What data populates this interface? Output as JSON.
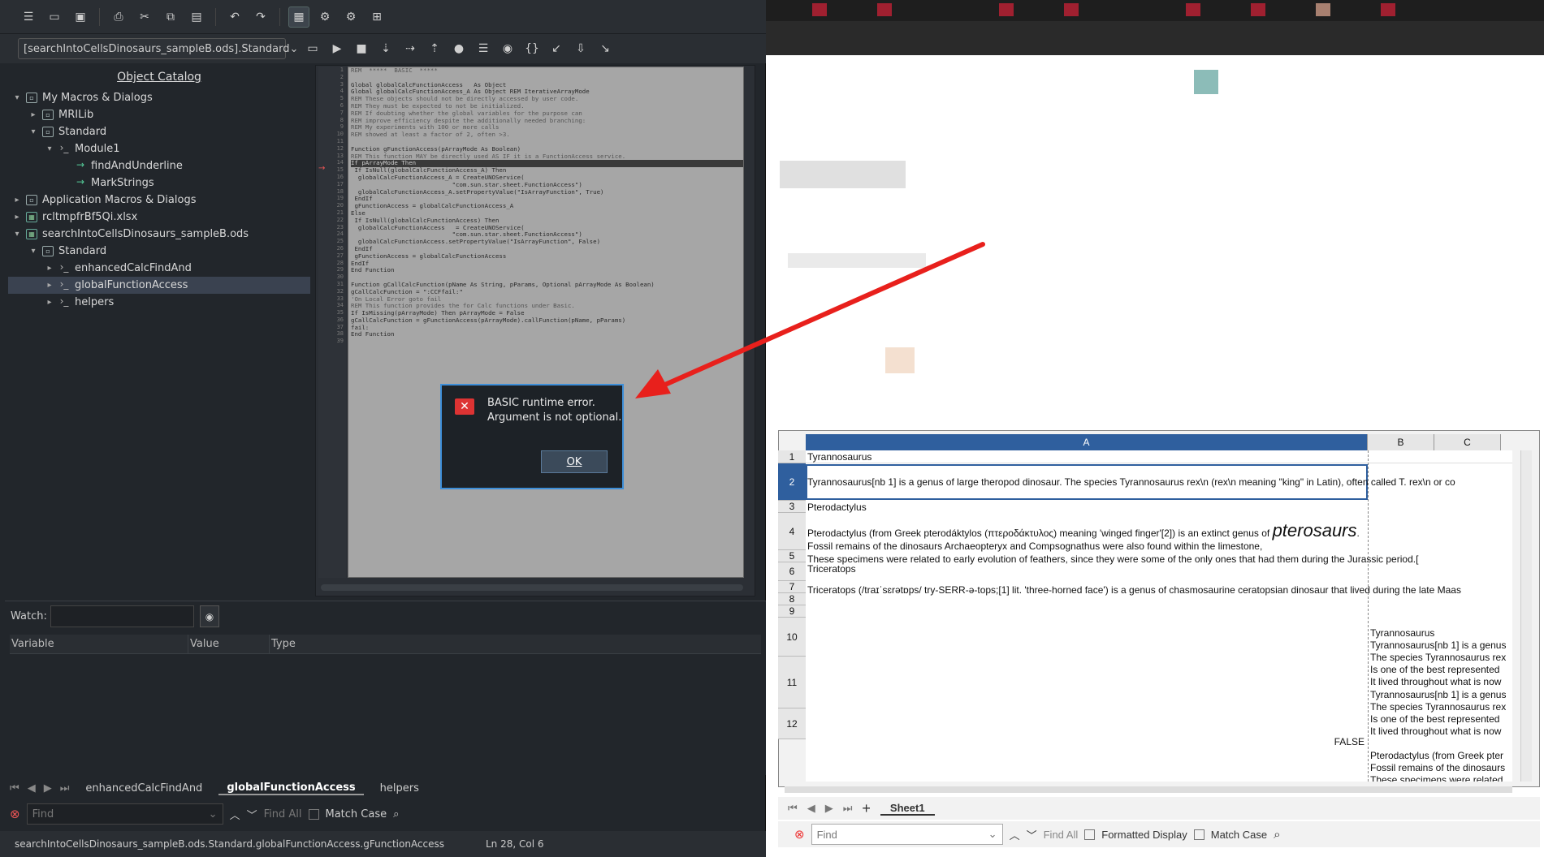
{
  "ide": {
    "library_select": "[searchIntoCellsDinosaurs_sampleB.ods].Standard",
    "catalog_title": "Object Catalog",
    "tree": [
      {
        "label": "My Macros & Dialogs",
        "level": 0,
        "icon": "box",
        "twisty": "▾"
      },
      {
        "label": "MRILib",
        "level": 1,
        "icon": "box",
        "twisty": "▸"
      },
      {
        "label": "Standard",
        "level": 1,
        "icon": "box",
        "twisty": "▾"
      },
      {
        "label": "Module1",
        "level": 2,
        "icon": "module",
        "twisty": "▾"
      },
      {
        "label": "findAndUnderline",
        "level": 3,
        "icon": "method",
        "twisty": ""
      },
      {
        "label": "MarkStrings",
        "level": 3,
        "icon": "method",
        "twisty": ""
      },
      {
        "label": "Application Macros & Dialogs",
        "level": 0,
        "icon": "box",
        "twisty": "▸"
      },
      {
        "label": "rcltmpfrBf5Qi.xlsx",
        "level": 0,
        "icon": "sheet",
        "twisty": "▸"
      },
      {
        "label": "searchIntoCellsDinosaurs_sampleB.ods",
        "level": 0,
        "icon": "sheet",
        "twisty": "▾"
      },
      {
        "label": "Standard",
        "level": 1,
        "icon": "box",
        "twisty": "▾"
      },
      {
        "label": "enhancedCalcFindAnd",
        "level": 2,
        "icon": "module",
        "twisty": "▸"
      },
      {
        "label": "globalFunctionAccess",
        "level": 2,
        "icon": "module",
        "twisty": "▸",
        "selected": true
      },
      {
        "label": "helpers",
        "level": 2,
        "icon": "module",
        "twisty": "▸"
      }
    ],
    "code_lines": [
      "REM  *****  BASIC  *****",
      "",
      "Global globalCalcFunctionAccess   As Object",
      "Global globalCalcFunctionAccess_A As Object REM IterativeArrayMode",
      "REM These objects should not be directly accessed by user code.",
      "REM They must be expected to not be initialized.",
      "REM If doubting whether the global variables for the purpose can",
      "REM improve efficiency despite the additionally needed branching:",
      "REM My experiments with 100 or more calls",
      "REM showed at least a factor of 2, often >3.",
      "",
      "Function gFunctionAccess(pArrayMode As Boolean)",
      "REM This function MAY be directly used AS IF it is a FunctionAccess service.",
      "If pArrayMode Then",
      " If IsNull(globalCalcFunctionAccess_A) Then",
      "  globalCalcFunctionAccess_A = CreateUNOService(",
      "                            \"com.sun.star.sheet.FunctionAccess\")",
      "  globalCalcFunctionAccess_A.setPropertyValue(\"IsArrayFunction\", True)",
      " EndIf",
      " gFunctionAccess = globalCalcFunctionAccess_A",
      "Else",
      " If IsNull(globalCalcFunctionAccess) Then",
      "  globalCalcFunctionAccess   = CreateUNOService(",
      "                            \"com.sun.star.sheet.FunctionAccess\")",
      "  globalCalcFunctionAccess.setPropertyValue(\"IsArrayFunction\", False)",
      " EndIf",
      " gFunctionAccess = globalCalcFunctionAccess",
      "EndIf",
      "End Function",
      "",
      "Function gCallCalcFunction(pName As String, pParams, Optional pArrayMode As Boolean)",
      "gCallCalcFunction = \":CCFfail:\"",
      "'On Local Error goto fail",
      "REM This function provides the for Calc functions under Basic.",
      "If IsMissing(pArrayMode) Then pArrayMode = False",
      "gCallCalcFunction = gFunctionAccess(pArrayMode).callFunction(pName, pParams)",
      "fail:",
      "End Function",
      ""
    ],
    "watch_label": "Watch:",
    "watch_columns": [
      "Variable",
      "Value",
      "Type"
    ],
    "module_tabs": [
      "enhancedCalcFindAnd",
      "globalFunctionAccess",
      "helpers"
    ],
    "active_tab": "globalFunctionAccess",
    "find_placeholder": "Find",
    "find_all": "Find All",
    "match_case": "Match Case",
    "status_path": "searchIntoCellsDinosaurs_sampleB.ods.Standard.globalFunctionAccess.gFunctionAccess",
    "status_position": "Ln 28, Col 6"
  },
  "dialog": {
    "line1": "BASIC runtime error.",
    "line2": "Argument is not optional.",
    "ok_label": "OK",
    "icon": "error-icon"
  },
  "calc": {
    "columns": [
      "A",
      "B",
      "C"
    ],
    "rows": [
      "1",
      "2",
      "3",
      "4",
      "5",
      "6",
      "7",
      "8",
      "9",
      "10",
      "11",
      "12"
    ],
    "cells": {
      "r1a": "Tyrannosaurus",
      "r2a": "Tyrannosaurus[nb 1] is a genus of large theropod dinosaur. The species Tyrannosaurus rex\\n (rex\\n meaning \"king\" in Latin), often called T. rex\\n or co",
      "r3a": "Pterodactylus",
      "r4a_1": "Pterodactylus (from Greek pterodáktylos (πτεροδάκτυλος) meaning 'winged finger'[2]) is an extinct genus of",
      "r4a_big": "pterosaurs",
      "r4a_dot": ".",
      "r4a_2": "Fossil remains of the dinosaurs Archaeopteryx and Compsognathus were also found within the limestone,",
      "r4a_3": "These specimens were related to early evolution of feathers, since they were some of the only ones that had them during the Jurassic period.[",
      "r5a": "Triceratops",
      "r6a": "Triceratops (/traɪˈsɛrətɒps/ try-SERR-ə-tops;[1] lit. 'three-horned face') is a genus of chasmosaurine ceratopsian dinosaur that lived during the late Maas",
      "r9b": "Tyrannosaurus",
      "r10b": [
        "Tyrannosaurus[nb 1] is a genus",
        "The species Tyrannosaurus rex",
        "Is one of the best represented",
        "It lived throughout what is now"
      ],
      "r11b": [
        "Tyrannosaurus[nb 1] is a genus",
        "The species Tyrannosaurus rex",
        "Is one of the best represented",
        "It lived throughout what is now"
      ],
      "r11a": "FALSE",
      "r12b": [
        "Pterodactylus (from Greek pter",
        "Fossil remains of the dinosaurs",
        "These specimens were related"
      ]
    },
    "sheet_tab": "Sheet1",
    "find_placeholder": "Find",
    "find_all": "Find All",
    "formatted_display": "Formatted Display",
    "match_case": "Match Case"
  },
  "colors": {
    "accent": "#2f5f9e",
    "arrow": "#e8201c",
    "dialog_border": "#3d8ed8"
  }
}
